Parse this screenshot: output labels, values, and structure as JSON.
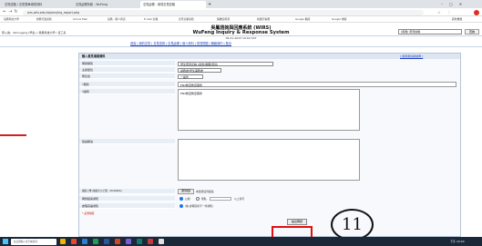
{
  "browser": {
    "tabs": [
      {
        "label": "意見信箱 / 意見表單填寫資料"
      },
      {
        "label": "意見處理系統 - WuFeng"
      },
      {
        "label": "意見處理 - 填寫意見信箱"
      }
    ],
    "url": "wrs.wfu.edu.tw/wrs/Inq_report.php",
    "bookmarks": [
      "吳鳳科技大學",
      "校務行政系統",
      "School Mail",
      "吳鳳 - 個人資訊",
      "E-mail 信箱",
      "意見信箱系統",
      "圖書館資源",
      "校園行事曆",
      "Google 翻譯",
      "Google 地圖",
      "其他書籤"
    ]
  },
  "header": {
    "title_cn": "吳鳳諮詢與回應系統 (WIRS)",
    "title_en": "WuFeng Inquiry & Response System",
    "datetime": "09-21-2023 10:04 CST",
    "login_info": "登入為：lishungjing (學生) / 吳鳳科技大學 / 資工系",
    "nav": "首頁 | 我的意見 | 意見查詢 | 意見處理 | 個人資料 | 常見問題 | 聯絡我們 | 登出",
    "site_select": "[吳鳳] 意見信箱",
    "search_button": "查詢"
  },
  "form": {
    "section_title": "輸入意見填寫資料",
    "help_link": "[ 使用者協助說明 ]",
    "rows": {
      "category_label": "問題類別",
      "category_value": "學生意見反映 (宿舍/餐廳/環境)",
      "unit_label": "主辦單位",
      "unit_value": "總務處/學生事務處",
      "priority_label": "緊急性",
      "priority_value": "一般件",
      "subject_label": "*標題",
      "subject_value": "EN2教室教室需修",
      "desc_label": "*說明",
      "desc_value": "EN2教室教室需修",
      "solution_label": "建議解決",
      "attach_label": "檔案上傳 (檔案大小上限：20,000kb)",
      "attach_browse": "選擇檔案",
      "attach_file": "未選擇任何檔案",
      "notify_label": "問題結案通知",
      "notify_opt1": "公開",
      "notify_opt2": "隱私",
      "notify_opt3": "以上皆可",
      "contact_label": "處理完畢通知",
      "contact_value": "(無 處理完畢不一律通知)",
      "required_note": "* 必須填寫",
      "submit_label": "提出問題"
    }
  },
  "annotation": {
    "number": "11"
  },
  "taskbar": {
    "search_placeholder": "在這裡輸入文字來搜尋",
    "clock": "下午 10:04"
  }
}
